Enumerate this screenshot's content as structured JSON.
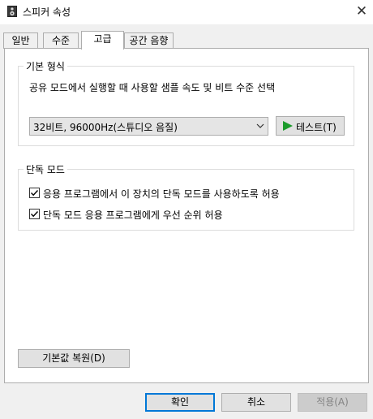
{
  "window": {
    "title": "스피커 속성",
    "icon": "speaker-icon",
    "close_symbol": "✕"
  },
  "tabs": [
    {
      "label": "일반",
      "active": false
    },
    {
      "label": "수준",
      "active": false
    },
    {
      "label": "고급",
      "active": true
    },
    {
      "label": "공간 음향",
      "active": false
    }
  ],
  "default_format": {
    "group_label": "기본 형식",
    "description": "공유 모드에서 실행할 때 사용할 샘플 속도 및 비트 수준 선택",
    "selected_format": "32비트, 96000Hz(스튜디오 음질)",
    "test_button_label": "테스트(T)"
  },
  "exclusive_mode": {
    "group_label": "단독 모드",
    "options": [
      {
        "label": "응용 프로그램에서 이 장치의 단독 모드를 사용하도록 허용",
        "checked": true
      },
      {
        "label": "단독 모드 응용 프로그램에게 우선 순위 허용",
        "checked": true
      }
    ]
  },
  "restore_defaults_label": "기본값 복원(D)",
  "footer": {
    "ok_label": "확인",
    "cancel_label": "취소",
    "apply_label": "적용(A)",
    "apply_disabled": true
  },
  "colors": {
    "play_icon": "#1b9b2b",
    "focus_border": "#0078d7",
    "disabled_text": "#838383"
  }
}
